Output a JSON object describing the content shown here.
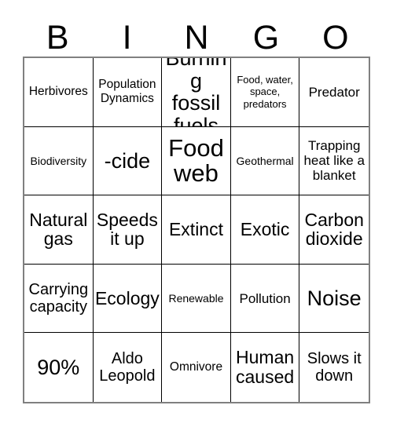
{
  "card": {
    "title": "BINGO Card",
    "header_letters": [
      "B",
      "I",
      "N",
      "G",
      "O"
    ],
    "columns": 5,
    "rows": 5,
    "grid_line_color": "#000000",
    "border_color": "#808080",
    "background_color": "#ffffff",
    "text_color": "#000000",
    "cells": [
      {
        "text": "Herbivores",
        "size": "fs-s"
      },
      {
        "text": "Population Dynamics",
        "size": "fs-s"
      },
      {
        "text": "Burning fossil fuels",
        "size": "fs-xxl"
      },
      {
        "text": "Food, water, space, predators",
        "size": "fs-xxs"
      },
      {
        "text": "Predator",
        "size": "fs-m"
      },
      {
        "text": "Biodiversity",
        "size": "fs-xs"
      },
      {
        "text": "-cide",
        "size": "fs-xxl"
      },
      {
        "text": "Food web",
        "size": "fs-huge"
      },
      {
        "text": "Geothermal",
        "size": "fs-xs"
      },
      {
        "text": "Trapping heat like a blanket",
        "size": "fs-m"
      },
      {
        "text": "Natural gas",
        "size": "fs-xl"
      },
      {
        "text": "Speeds it up",
        "size": "fs-xl"
      },
      {
        "text": "Extinct",
        "size": "fs-xl"
      },
      {
        "text": "Exotic",
        "size": "fs-xl"
      },
      {
        "text": "Carbon dioxide",
        "size": "fs-xl"
      },
      {
        "text": "Carrying capacity",
        "size": "fs-l"
      },
      {
        "text": "Ecology",
        "size": "fs-xl"
      },
      {
        "text": "Renewable",
        "size": "fs-xs"
      },
      {
        "text": "Pollution",
        "size": "fs-m"
      },
      {
        "text": "Noise",
        "size": "fs-xxl"
      },
      {
        "text": "90%",
        "size": "fs-xxl"
      },
      {
        "text": "Aldo Leopold",
        "size": "fs-l"
      },
      {
        "text": "Omnivore",
        "size": "fs-s"
      },
      {
        "text": "Human caused",
        "size": "fs-xl"
      },
      {
        "text": "Slows it down",
        "size": "fs-l"
      }
    ]
  }
}
